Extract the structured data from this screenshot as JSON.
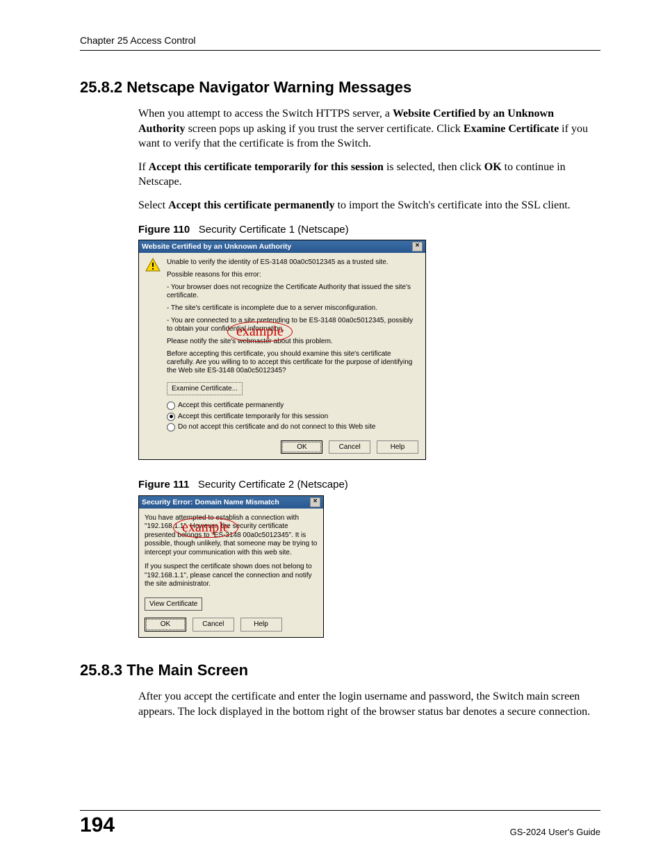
{
  "header": {
    "chapter": "Chapter 25 Access Control"
  },
  "section1": {
    "num_title": "25.8.2  Netscape Navigator Warning Messages",
    "p1a": "When you attempt to access the Switch HTTPS server, a ",
    "p1b_bold": "Website Certified by an Unknown Authority",
    "p1c": " screen pops up asking if you trust the server certificate. Click ",
    "p1d_bold": "Examine Certificate",
    "p1e": " if you want to verify that the certificate is from the Switch.",
    "p2a": "If ",
    "p2b_bold": "Accept this certificate temporarily for this session",
    "p2c": " is selected, then click ",
    "p2d_bold": "OK",
    "p2e": " to continue in Netscape.",
    "p3a": "Select ",
    "p3b_bold": "Accept this certificate permanently",
    "p3c": " to import the Switch's certificate into the SSL client."
  },
  "fig110": {
    "label": "Figure 110",
    "caption": "Security Certificate 1 (Netscape)",
    "title": "Website Certified by an Unknown Authority",
    "close": "×",
    "line1": "Unable to verify the identity of ES-3148 00a0c5012345 as a trusted site.",
    "line2": "Possible reasons for this error:",
    "b1": "- Your browser does not recognize the Certificate Authority that issued the site's certificate.",
    "b2": "- The site's certificate is incomplete due to a server misconfiguration.",
    "b3": "- You are connected to a site pretending to be ES-3148 00a0c5012345, possibly to obtain your confidential information.",
    "line3": "Please notify the site's webmaster about this problem.",
    "line4": "Before accepting this certificate, you should examine this site's certificate carefully. Are you willing to to accept this certificate for the purpose of identifying the Web site ES-3148 00a0c5012345?",
    "exam_btn": "Examine Certificate...",
    "r1": "Accept this certificate permanently",
    "r2": "Accept this certificate temporarily for this session",
    "r3": "Do not accept this certificate and do not connect to this Web site",
    "ok": "OK",
    "cancel": "Cancel",
    "help": "Help",
    "stamp": "example"
  },
  "fig111": {
    "label": "Figure 111",
    "caption": "Security Certificate 2 (Netscape)",
    "title": "Security Error: Domain Name Mismatch",
    "close": "×",
    "p1": "You have attempted to establish a connection with \"192.168.1.1\". However, the security certificate presented belongs to \"ES-3148 00a0c5012345\". It is possible, though unlikely, that someone may be trying to intercept your communication with this web site.",
    "p2": "If you suspect the certificate shown does not belong to \"192.168.1.1\", please cancel the connection and notify the site administrator.",
    "view_btn": "View Certificate",
    "ok": "OK",
    "cancel": "Cancel",
    "help": "Help",
    "stamp": "example"
  },
  "section2": {
    "num_title": "25.8.3  The Main Screen",
    "p1": "After you accept the certificate and enter the login username and password, the Switch main screen appears. The lock displayed in the bottom right of the browser status bar denotes a secure connection."
  },
  "footer": {
    "page": "194",
    "guide": "GS-2024 User's Guide"
  }
}
